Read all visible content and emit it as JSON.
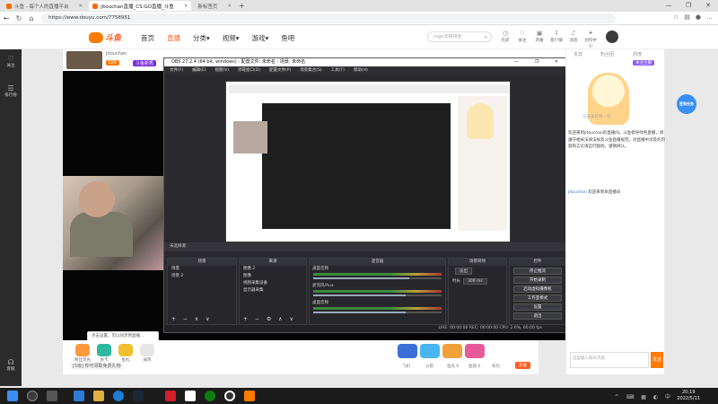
{
  "browser": {
    "tabs": [
      {
        "label": "斗鱼 - 每个人的直播平台",
        "active": false
      },
      {
        "label": "jitouchan直播_CS:GO直播_斗鱼",
        "active": true
      },
      {
        "label": "新标签页",
        "active": false
      }
    ],
    "url": "https://www.douyu.com/7758951",
    "window_buttons": [
      "—",
      "❐",
      "✕"
    ]
  },
  "site": {
    "logo_text": "斗鱼",
    "nav": [
      {
        "label": "首页",
        "active": false
      },
      {
        "label": "直播",
        "active": true
      },
      {
        "label": "分类▾",
        "active": false
      },
      {
        "label": "视频▾",
        "active": false
      },
      {
        "label": "游戏▾",
        "active": false
      },
      {
        "label": "鱼吧",
        "active": false
      }
    ],
    "search_placeholder": "csgo天梯排名",
    "header_icons": [
      {
        "label": "历史",
        "icon": "clock-icon"
      },
      {
        "label": "关注",
        "icon": "heart-icon"
      },
      {
        "label": "开播",
        "icon": "camera-icon"
      },
      {
        "label": "客户端",
        "icon": "download-icon"
      },
      {
        "label": "消息",
        "icon": "bell-icon"
      },
      {
        "label": "创作中心",
        "icon": "lightbulb-icon"
      }
    ]
  },
  "left_rail": [
    {
      "label": "关注",
      "icon": "heart-icon"
    },
    {
      "label": "排行榜",
      "icon": "list-icon"
    },
    {
      "label": "客服",
      "icon": "headset-icon"
    }
  ],
  "room": {
    "name": "jitouchan",
    "level": "LV9",
    "rank_badge": "斗鱼新秀"
  },
  "obs": {
    "title": "OBS 27.2.4 (64 bit, windows) - 配置文件: 未命名 - 场景: 未命名",
    "menu": [
      "文件(F)",
      "编辑(E)",
      "视图(V)",
      "停靠窗口(D)",
      "配置文件(P)",
      "场景集合(S)",
      "工具(T)",
      "帮助(H)"
    ],
    "scene_bar": "未选择源",
    "scenes_header": "场景",
    "scenes": [
      "场景",
      "场景 2"
    ],
    "sources_header": "来源",
    "sources": [
      "图像 2",
      "图像",
      "视频采集设备",
      "显示器采集"
    ],
    "mixer_header": "混音器",
    "mixer": [
      {
        "name": "桌面音频",
        "level": 0.75
      },
      {
        "name": "麦克风/Aux",
        "level": 0.72
      },
      {
        "name": "桌面音频",
        "level": 0.72
      }
    ],
    "transitions_header": "场景转场",
    "transition": "淡出",
    "duration_label": "时长",
    "duration": "300 ms",
    "controls_header": "控件",
    "controls": [
      "停止推流",
      "开始录制",
      "启动虚拟摄像机",
      "工作室模式",
      "设置",
      "退出"
    ],
    "status": "LIVE: 00:00:00   REC: 00:00:00   CPU: 2.6%, 60.00 fps"
  },
  "toast": "点击设置，可以同步到直播...",
  "gift_bar": {
    "notice": "[5级] 你可领取免费礼物",
    "gifts": [
      "粉丝荧光棒",
      "办卡",
      "鱼丸",
      "弱鸡"
    ],
    "right_gifts": [
      "飞机",
      "火箭",
      "超级火箭",
      "666"
    ],
    "stats": [
      "鱼丸 0",
      "鱼翅 0",
      "背包"
    ],
    "charge": "充值"
  },
  "chat": {
    "tabs": [
      "贵宾",
      "粉丝团",
      "周榜"
    ],
    "follow_btn": "关注主播",
    "mascot_caption": "记录美好每一刻",
    "system_msg": "欢迎来到jitouchan的直播间。斗鱼倡导绿色直播，请遵守相关法律法规及斗鱼直播规范，对直播中涉及的内容和言论请自行甄别，谨慎辨认。",
    "user_msg_name": "jitouchan",
    "user_msg": "欢迎来到本直播间",
    "input_placeholder": "这里输入聊天内容",
    "send": "发送"
  },
  "signin_badge": "签到任务",
  "taskbar": {
    "time": "20:19",
    "date": "2022/5/11"
  }
}
